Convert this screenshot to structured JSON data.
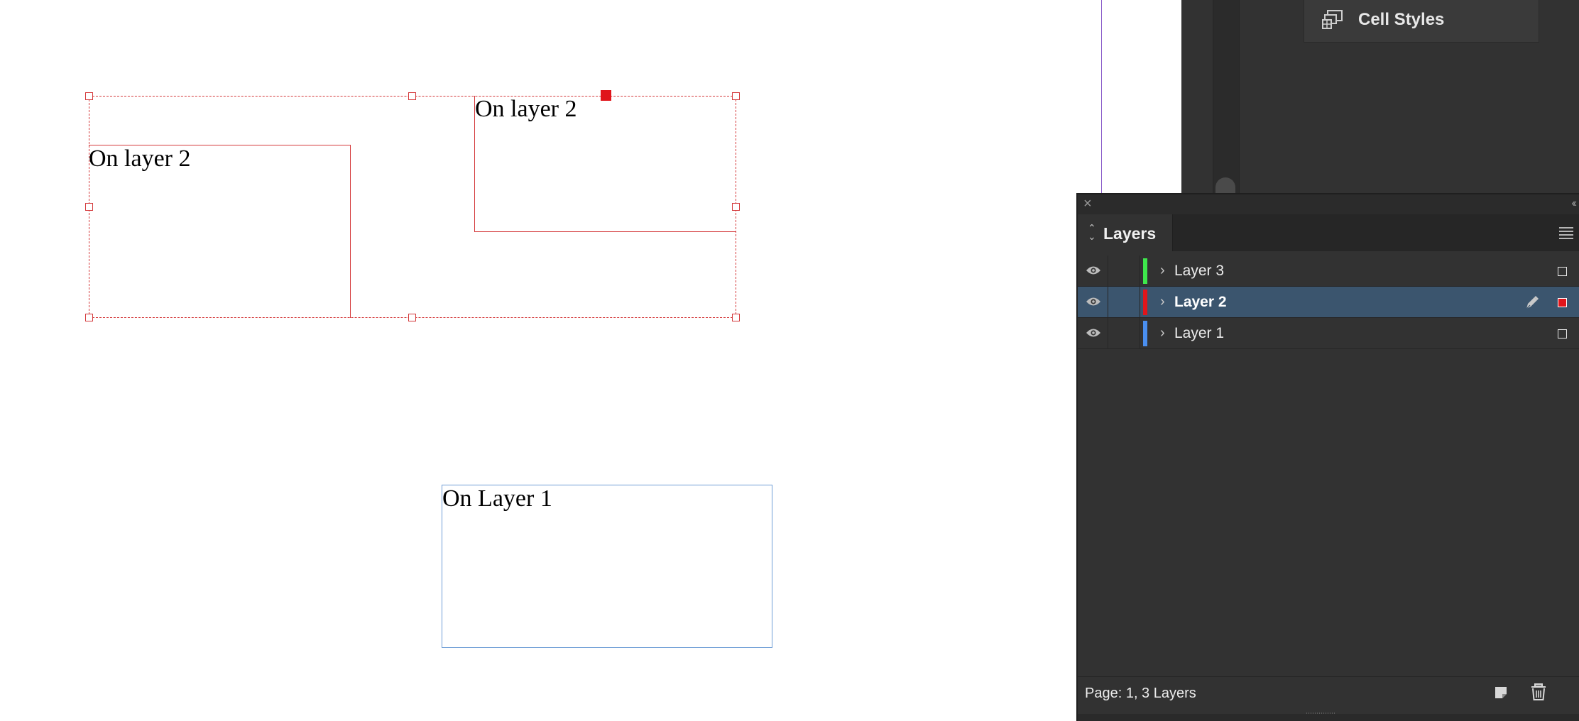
{
  "canvas": {
    "frames": [
      {
        "text": "On layer 2",
        "layer": "Layer 2"
      },
      {
        "text": "On layer 2",
        "layer": "Layer 2"
      },
      {
        "text": "On Layer 1",
        "layer": "Layer 1"
      }
    ],
    "selection_color": "#d4383a",
    "layer1_color": "#6f9ed6"
  },
  "styles_panel": {
    "item_label": "Cell Styles",
    "item_icon": "cell-styles-icon"
  },
  "layers_panel": {
    "tab_label": "Layers",
    "close_glyph": "×",
    "collapse_glyph": "‹‹",
    "layers": [
      {
        "name": "Layer 3",
        "color": "#3ee84c",
        "visible": true,
        "selected": false
      },
      {
        "name": "Layer 2",
        "color": "#e0151b",
        "visible": true,
        "selected": true
      },
      {
        "name": "Layer 1",
        "color": "#4a8ff0",
        "visible": true,
        "selected": false
      }
    ],
    "footer_status": "Page: 1, 3 Layers",
    "icons": {
      "visibility": "eye-icon",
      "expand": "chevron-right-icon",
      "edit": "pen-icon",
      "new_layer": "new-layer-icon",
      "delete": "trash-icon",
      "menu": "hamburger-menu-icon"
    }
  }
}
